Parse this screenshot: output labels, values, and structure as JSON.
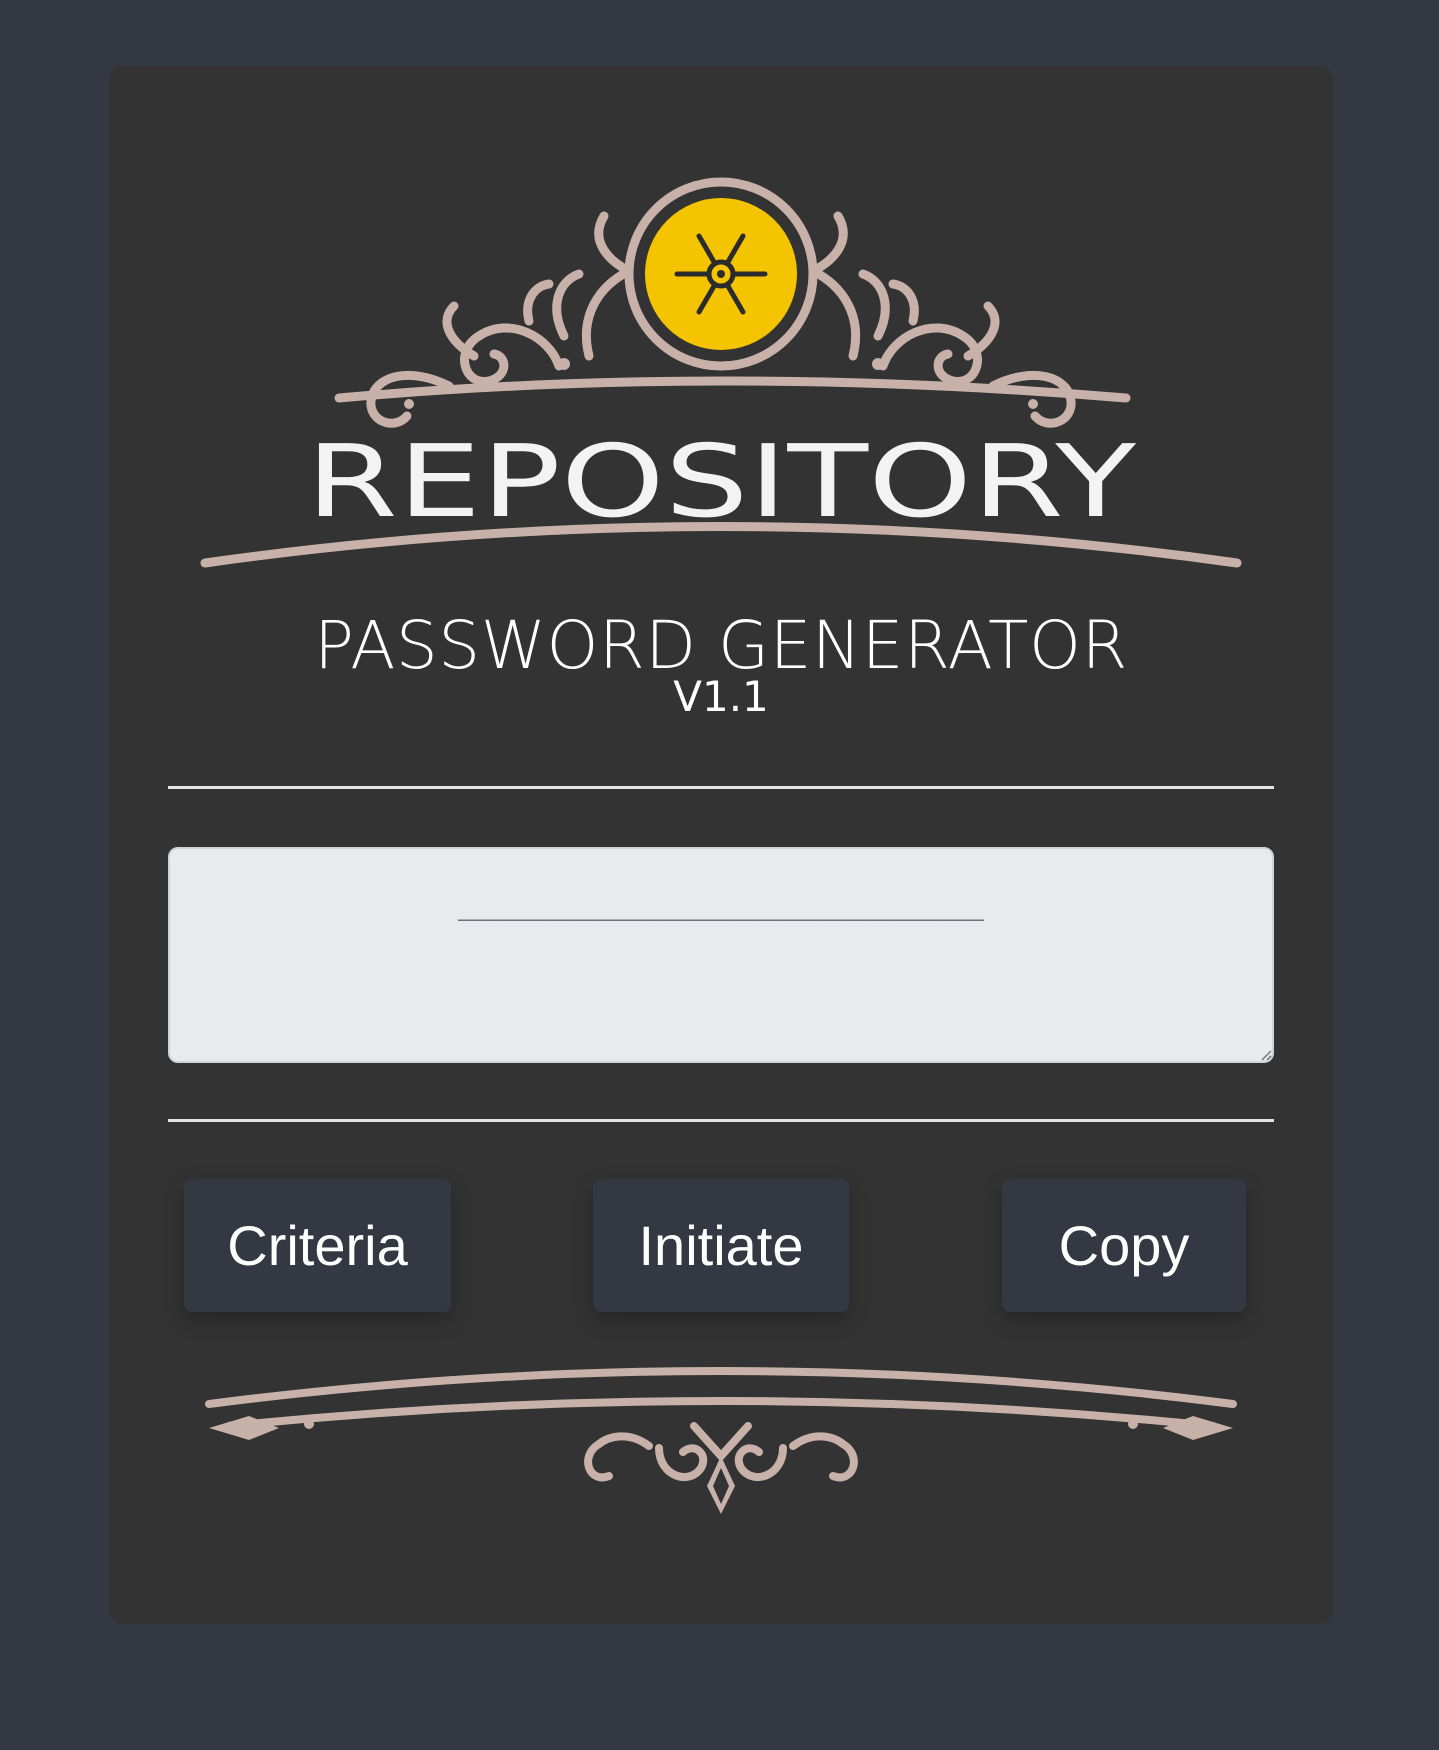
{
  "logo": {
    "wordmark": "REPOSITORY",
    "emblem_icon": "vault-dial-icon",
    "accent_color": "#f5c400",
    "ornament_color": "#c7b1a8"
  },
  "header": {
    "title": "PASSWORD GENERATOR",
    "version": "V1.1"
  },
  "password_output": {
    "placeholder": "_______________________",
    "value": ""
  },
  "buttons": {
    "criteria_label": "Criteria",
    "initiate_label": "Initiate",
    "copy_label": "Copy"
  },
  "colors": {
    "page_background": "#343842",
    "card_background": "#333333",
    "button_background": "#343842",
    "field_background": "#e8ebee"
  }
}
